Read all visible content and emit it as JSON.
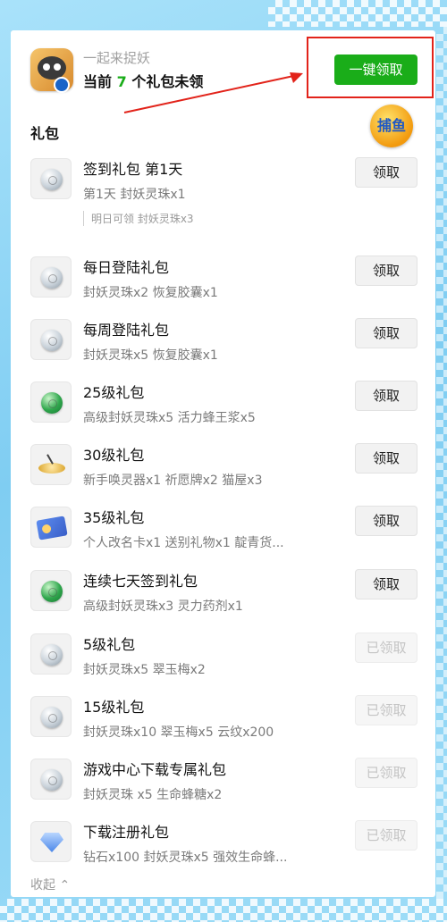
{
  "header": {
    "app_subtitle": "一起来捉妖",
    "status_prefix": "当前",
    "pending_count": "7",
    "status_suffix": "个礼包未领",
    "claim_all_label": "一键领取"
  },
  "section": {
    "title": "礼包",
    "badge_text": "捕鱼"
  },
  "items": [
    {
      "title": "签到礼包 第1天",
      "desc": "第1天 封妖灵珠x1",
      "note": "明日可领 封妖灵珠x3",
      "button": "领取",
      "claimed": false,
      "icon": "white-orb-icon"
    },
    {
      "title": "每日登陆礼包",
      "desc": "封妖灵珠x2 恢复胶囊x1",
      "button": "领取",
      "claimed": false,
      "icon": "white-orb-icon"
    },
    {
      "title": "每周登陆礼包",
      "desc": "封妖灵珠x5 恢复胶囊x1",
      "button": "领取",
      "claimed": false,
      "icon": "white-orb-icon"
    },
    {
      "title": "25级礼包",
      "desc": "高级封妖灵珠x5 活力蜂王浆x5",
      "button": "领取",
      "claimed": false,
      "icon": "green-orb-icon"
    },
    {
      "title": "30级礼包",
      "desc": "新手唤灵器x1 祈愿牌x2 猫屋x3",
      "button": "领取",
      "claimed": false,
      "icon": "summoner-icon"
    },
    {
      "title": "35级礼包",
      "desc": "个人改名卡x1 送别礼物x1 靛青货...",
      "button": "领取",
      "claimed": false,
      "icon": "rename-card-icon"
    },
    {
      "title": "连续七天签到礼包",
      "desc": "高级封妖灵珠x3 灵力药剂x1",
      "button": "领取",
      "claimed": false,
      "icon": "green-orb-icon"
    },
    {
      "title": "5级礼包",
      "desc": "封妖灵珠x5 翠玉梅x2",
      "button": "已领取",
      "claimed": true,
      "icon": "white-orb-icon"
    },
    {
      "title": "15级礼包",
      "desc": "封妖灵珠x10 翠玉梅x5 云纹x200",
      "button": "已领取",
      "claimed": true,
      "icon": "white-orb-icon"
    },
    {
      "title": "游戏中心下载专属礼包",
      "desc": "封妖灵珠 x5 生命蜂糖x2",
      "button": "已领取",
      "claimed": true,
      "icon": "white-orb-icon"
    },
    {
      "title": "下载注册礼包",
      "desc": "钻石x100 封妖灵珠x5 强效生命蜂...",
      "button": "已领取",
      "claimed": true,
      "icon": "diamond-icon"
    }
  ],
  "footer": {
    "collapse_label": "收起 ⌃"
  },
  "colors": {
    "accent_green": "#1aad19",
    "annotation_red": "#e2231a",
    "background_blue": "#8fd3f4"
  }
}
